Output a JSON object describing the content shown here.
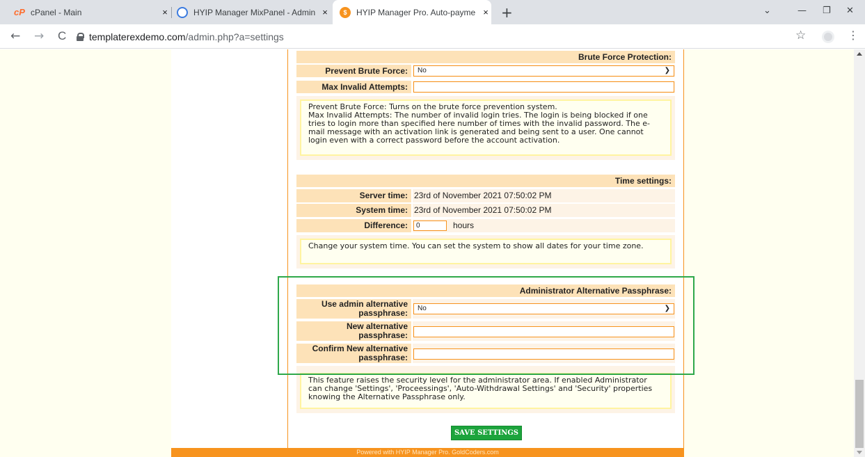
{
  "browser": {
    "tabs": [
      {
        "title": "cPanel - Main",
        "close": "×"
      },
      {
        "title": "HYIP Manager MixPanel - Admin",
        "close": "×"
      },
      {
        "title": "HYIP Manager Pro. Auto-paymen",
        "close": "×"
      }
    ],
    "new_tab": "+",
    "window_controls": {
      "minimize": "—",
      "restore": "❐",
      "close": "✕",
      "dropdown": "⌄"
    },
    "nav": {
      "back": "←",
      "forward": "→",
      "reload": "C"
    },
    "url_host": "templaterexdemo.com",
    "url_path": "/admin.php?a=settings",
    "star": "☆",
    "menu": "⋮"
  },
  "brute_force": {
    "header": "Brute Force Protection:",
    "prevent_label": "Prevent Brute Force:",
    "prevent_value": "No",
    "max_label": "Max Invalid Attempts:",
    "max_value": "",
    "note_1": "Prevent Brute Force: Turns on the brute force prevention system.",
    "note_2": "Max Invalid Attempts: The number of invalid login tries. The login is being blocked if one tries to login more than specified here number of times with the invalid password. The e-mail message with an activation link is generated and being sent to a user. One cannot login even with a correct password before the account activation."
  },
  "time_settings": {
    "header": "Time settings:",
    "server_label": "Server time:",
    "server_value": "23rd of November 2021 07:50:02 PM",
    "system_label": "System time:",
    "system_value": "23rd of November 2021 07:50:02 PM",
    "difference_label": "Difference:",
    "difference_value": "0",
    "difference_unit": "hours",
    "note": "Change your system time. You can set the system to show all dates for your time zone."
  },
  "admin_passphrase": {
    "header": "Administrator Alternative Passphrase:",
    "use_label": "Use admin alternative passphrase:",
    "use_value": "No",
    "new_label": "New alternative passphrase:",
    "confirm_label": "Confirm New alternative passphrase:",
    "note": "This feature raises the security level for the administrator area. If enabled Administrator can change 'Settings', 'Proceessings', 'Auto-Withdrawal Settings' and 'Security' properties knowing the Alternative Passphrase only."
  },
  "save_button": "SAVE SETTINGS",
  "footer": "Powered with HYIP Manager Pro. GoldCoders.com",
  "colors": {
    "accent": "#f7931e",
    "label_bg": "#fde2b8",
    "save": "#1ca43c",
    "highlight": "#2ea84a"
  }
}
